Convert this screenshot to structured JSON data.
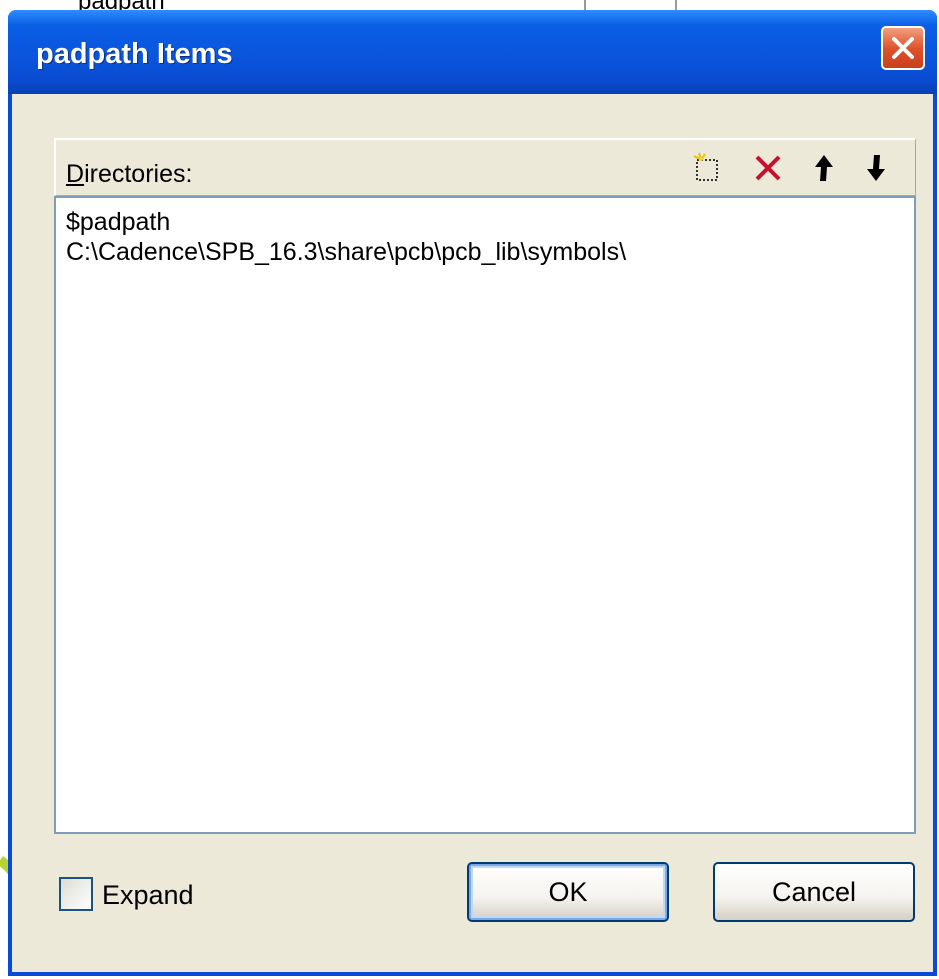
{
  "background": {
    "cell_text": "padpath"
  },
  "dialog": {
    "title": "padpath Items",
    "list_label_mnemonic": "D",
    "list_label_rest": "irectories:",
    "toolbar": {
      "icons": [
        "new-folder-icon",
        "delete-icon",
        "move-up-icon",
        "move-down-icon"
      ]
    },
    "items": [
      "$padpath",
      "C:\\Cadence\\SPB_16.3\\share\\pcb\\pcb_lib\\symbols\\"
    ],
    "expand_label": "Expand",
    "expand_checked": false,
    "ok_label": "OK",
    "cancel_label": "Cancel"
  },
  "colors": {
    "title_bar": "#0a55dc",
    "dialog_face": "#ece9d8",
    "close_button": "#e0542c",
    "delete_icon": "#c8102e"
  }
}
